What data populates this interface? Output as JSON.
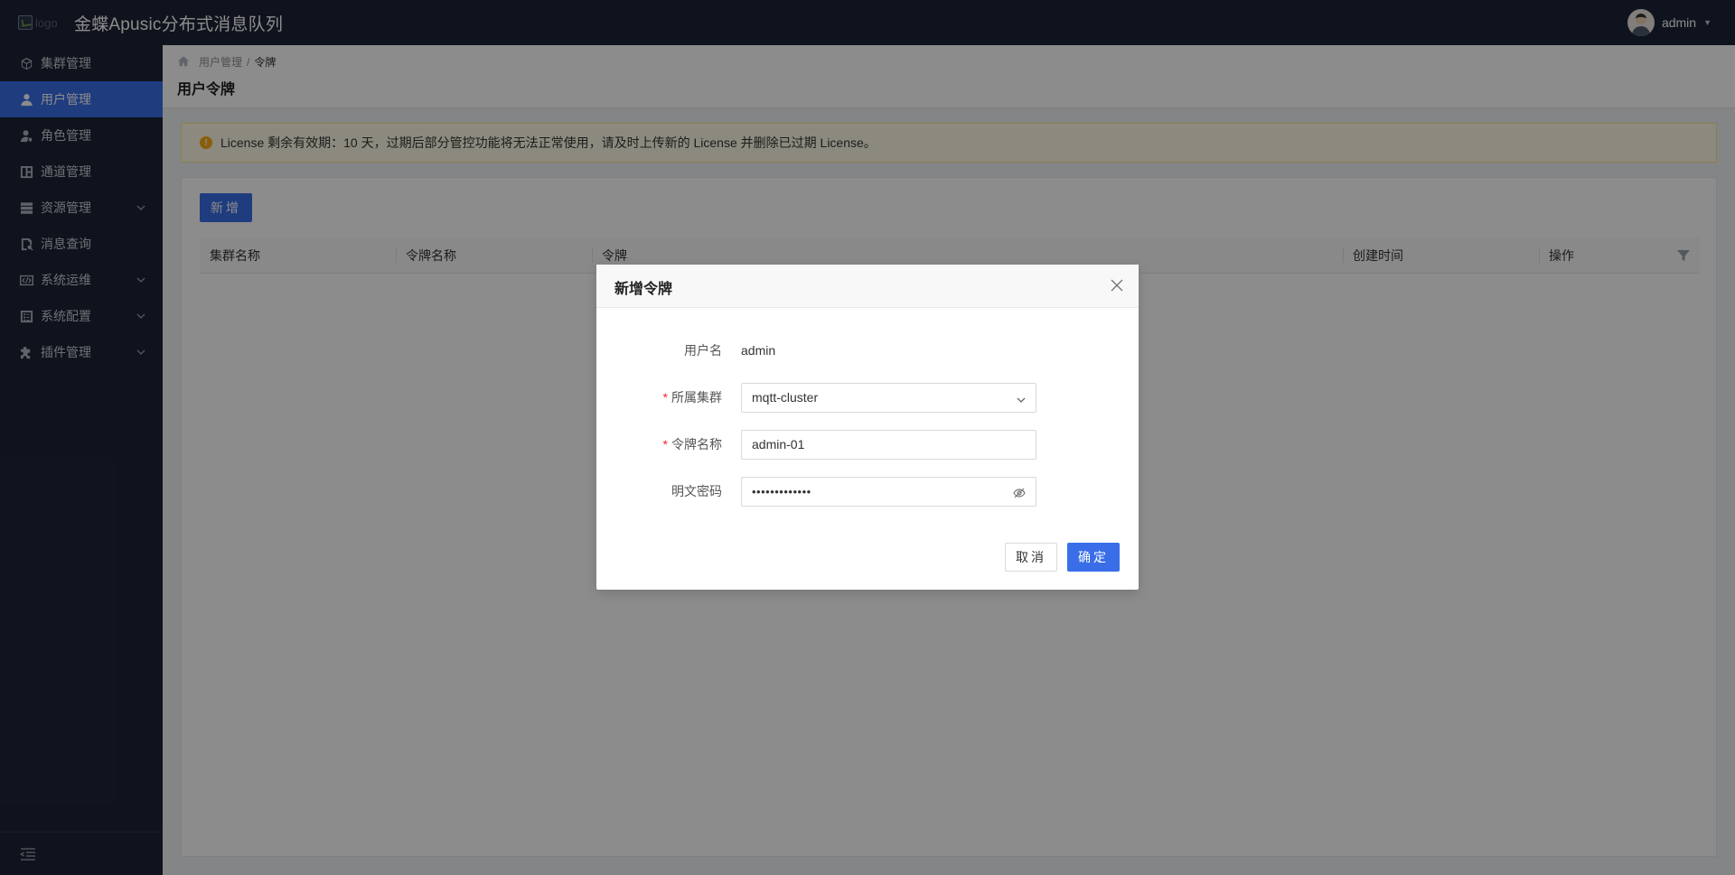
{
  "header": {
    "logo_alt": "logo",
    "app_title": "金蝶Apusic分布式消息队列",
    "user_name": "admin"
  },
  "sidebar": {
    "items": [
      {
        "label": "集群管理",
        "icon": "cube-icon",
        "active": false,
        "expandable": false
      },
      {
        "label": "用户管理",
        "icon": "user-icon",
        "active": true,
        "expandable": false
      },
      {
        "label": "角色管理",
        "icon": "role-icon",
        "active": false,
        "expandable": false
      },
      {
        "label": "通道管理",
        "icon": "channel-icon",
        "active": false,
        "expandable": false
      },
      {
        "label": "资源管理",
        "icon": "database-icon",
        "active": false,
        "expandable": true
      },
      {
        "label": "消息查询",
        "icon": "message-search-icon",
        "active": false,
        "expandable": false
      },
      {
        "label": "系统运维",
        "icon": "code-icon",
        "active": false,
        "expandable": true
      },
      {
        "label": "系统配置",
        "icon": "config-icon",
        "active": false,
        "expandable": true
      },
      {
        "label": "插件管理",
        "icon": "puzzle-icon",
        "active": false,
        "expandable": true
      }
    ]
  },
  "breadcrumb": {
    "parent": "用户管理",
    "separator": "/",
    "current": "令牌"
  },
  "page": {
    "title": "用户令牌"
  },
  "alert": {
    "text": "License 剩余有效期：10 天，过期后部分管控功能将无法正常使用，请及时上传新的 License 并删除已过期 License。"
  },
  "toolbar": {
    "add_label": "新增"
  },
  "table": {
    "columns": [
      "集群名称",
      "令牌名称",
      "令牌",
      "创建时间",
      "操作"
    ]
  },
  "modal": {
    "title": "新增令牌",
    "username_label": "用户名",
    "username_value": "admin",
    "cluster_label": "所属集群",
    "cluster_value": "mqtt-cluster",
    "token_name_label": "令牌名称",
    "token_name_value": "admin-01",
    "password_label": "明文密码",
    "password_value": "•••••••••••••",
    "cancel_label": "取消",
    "ok_label": "确定"
  },
  "colors": {
    "accent": "#3a6ee8",
    "sidebar_bg": "#1c2436",
    "required": "#f5222d",
    "warning": "#faad14"
  }
}
